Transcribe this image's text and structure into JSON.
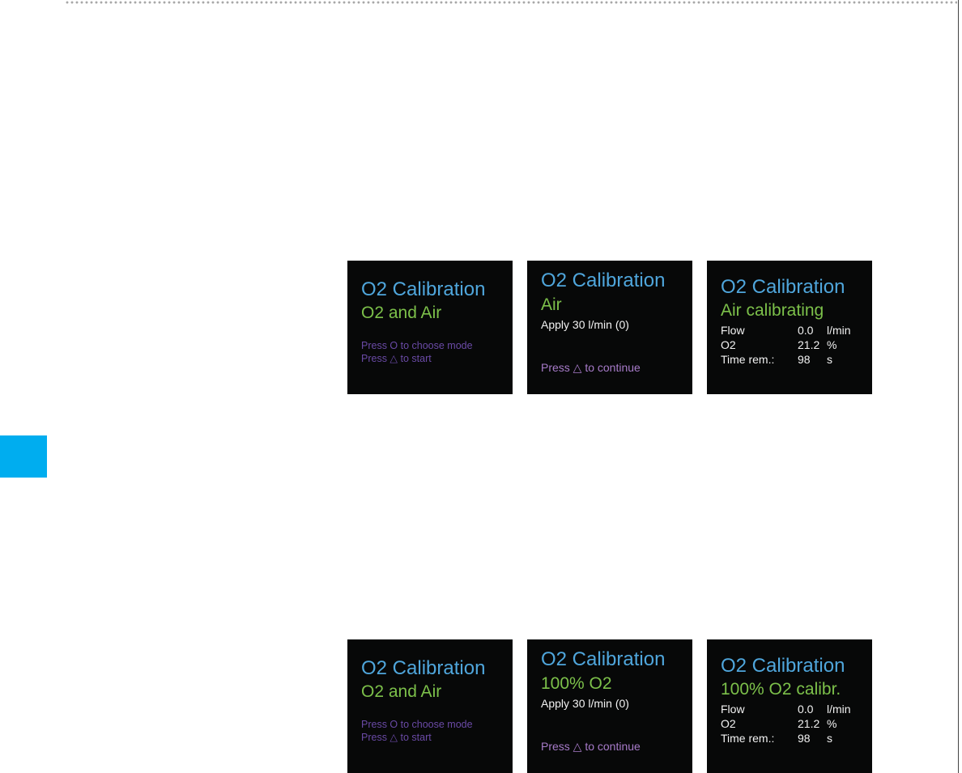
{
  "row1": {
    "select": {
      "title": "O2 Calibration",
      "mode": "O2 and Air",
      "hint1": "Press O to choose mode",
      "hint2": "Press △ to start"
    },
    "apply": {
      "title": "O2 Calibration",
      "mode": "Air",
      "apply": "Apply 30 l/min (0)",
      "continue": "Press △ to continue"
    },
    "progress": {
      "title": "O2 Calibration",
      "mode": "Air calibrating",
      "rows": [
        {
          "label": "Flow",
          "value": "0.0",
          "unit": "l/min"
        },
        {
          "label": "O2",
          "value": "21.2",
          "unit": "%"
        },
        {
          "label": "Time rem.:",
          "value": "98",
          "unit": "s"
        }
      ]
    }
  },
  "row2": {
    "select": {
      "title": "O2 Calibration",
      "mode": "O2 and Air",
      "hint1": "Press O to choose mode",
      "hint2": "Press △ to start"
    },
    "apply": {
      "title": "O2 Calibration",
      "mode": "100% O2",
      "apply": "Apply 30 l/min (0)",
      "continue": "Press △ to continue"
    },
    "progress": {
      "title": "O2 Calibration",
      "mode": "100% O2 calibr.",
      "rows": [
        {
          "label": "Flow",
          "value": "0.0",
          "unit": "l/min"
        },
        {
          "label": "O2",
          "value": "21.2",
          "unit": "%"
        },
        {
          "label": "Time rem.:",
          "value": "98",
          "unit": "s"
        }
      ]
    }
  },
  "colors": {
    "title": "#4fa6dc",
    "mode": "#7cc04a",
    "hint": "#6a4aa6",
    "continue": "#a77bc9",
    "tab": "#00adef",
    "screen_bg": "#070808"
  }
}
